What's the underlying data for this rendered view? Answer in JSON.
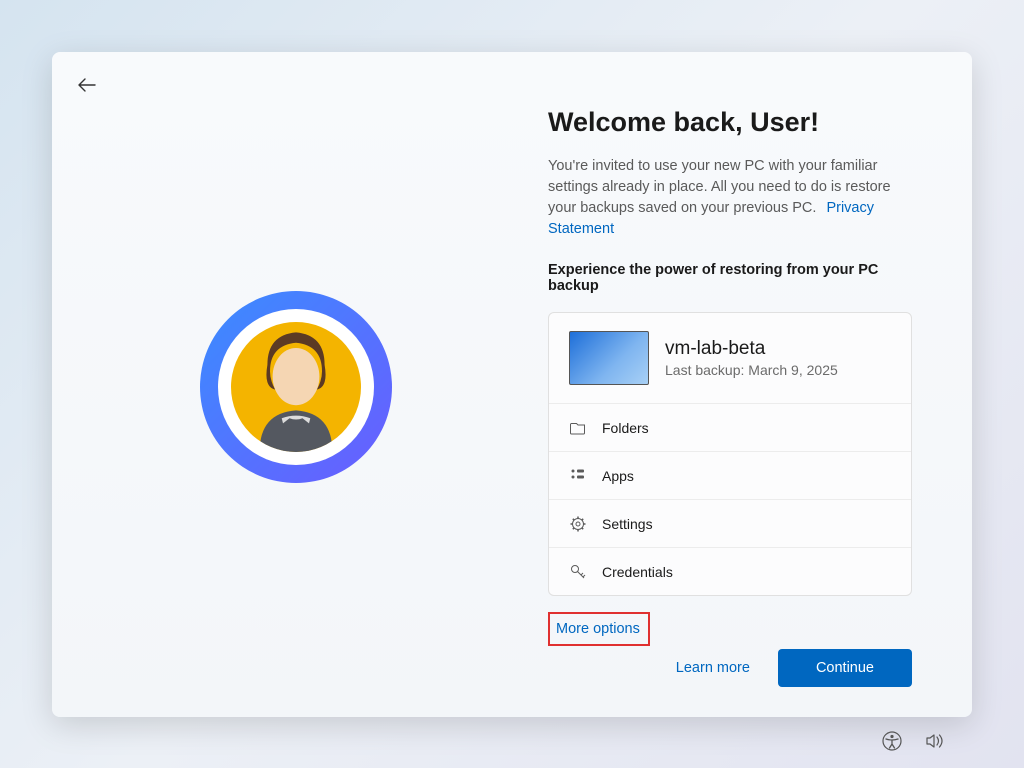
{
  "title": "Welcome back, User!",
  "description": "You're invited to use your new PC with your familiar settings already in place. All you need to do is restore your backups saved on your previous PC.",
  "privacy_link": "Privacy Statement",
  "subheading": "Experience the power of restoring from your PC backup",
  "backup": {
    "pc_name": "vm-lab-beta",
    "last_backup": "Last backup: March 9, 2025",
    "rows": [
      {
        "label": "Folders"
      },
      {
        "label": "Apps"
      },
      {
        "label": "Settings"
      },
      {
        "label": "Credentials"
      }
    ]
  },
  "more_options": "More options",
  "learn_more": "Learn more",
  "continue": "Continue"
}
